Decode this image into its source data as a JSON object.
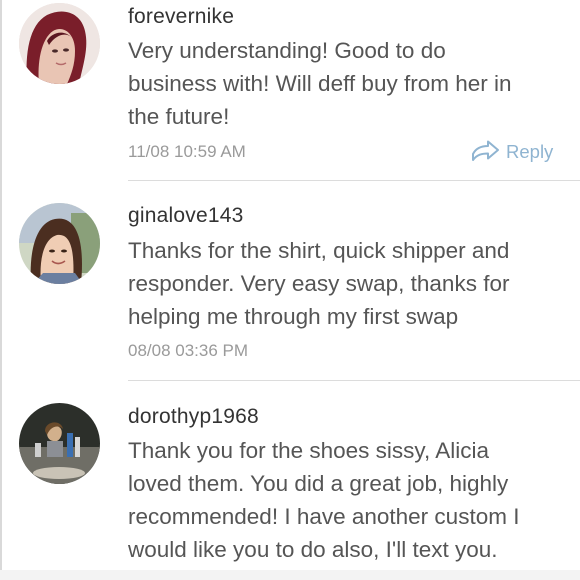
{
  "comments": [
    {
      "username": "forevernike",
      "lines": [
        "Very understanding! Good to do",
        "business with! Will deff buy from her in",
        "the future!"
      ],
      "timestamp": "11/08 10:59 AM",
      "reply_label": "Reply"
    },
    {
      "username": "ginalove143",
      "lines": [
        "Thanks for the shirt, quick shipper and",
        "responder. Very easy swap, thanks for",
        "helping me through my first swap"
      ],
      "timestamp": "08/08 03:36 PM"
    },
    {
      "username": "dorothyp1968",
      "lines": [
        "Thank you for the shoes sissy, Alicia",
        "loved them. You did a great job, highly",
        "recommended! I have another custom I",
        "would like you to do also, I'll text you."
      ]
    }
  ],
  "icons": {
    "reply": "reply-arrow-icon"
  },
  "colors": {
    "reply": "#8fb4d1",
    "username": "#333333",
    "body_text": "#555555",
    "timestamp": "#9a9a9a",
    "divider": "#dcdcdc"
  }
}
